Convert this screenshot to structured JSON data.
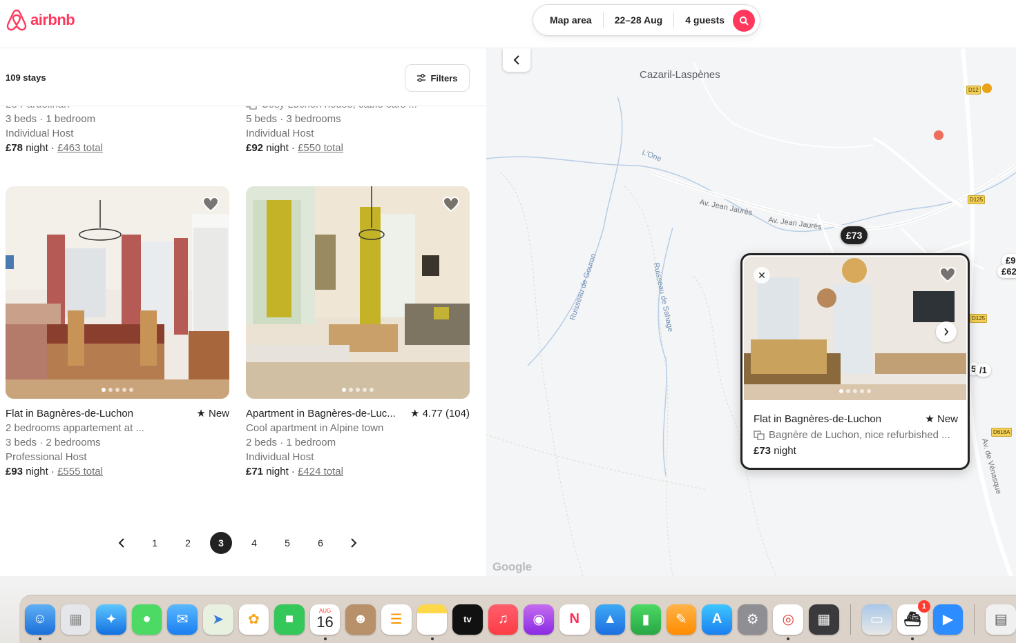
{
  "header": {
    "logo_text": "airbnb",
    "search": {
      "location": "Map area",
      "dates": "22–28 Aug",
      "guests": "4 guests"
    }
  },
  "results": {
    "count": "109 stays",
    "filters_label": "Filters"
  },
  "cards_top": [
    {
      "subtitle": "Le Pardeilhan",
      "beds": "3 beds · 1 bedroom",
      "host": "Individual Host",
      "price": "£78",
      "price_unit": "night",
      "total": "£463 total"
    },
    {
      "subtitle": "Cosy Luchon house, cable cars ...",
      "beds": "5 beds · 3 bedrooms",
      "host": "Individual Host",
      "price": "£92",
      "price_unit": "night",
      "total": "£550 total"
    }
  ],
  "cards": [
    {
      "title": "Flat in Bagnères-de-Luchon",
      "rating": "New",
      "subtitle": "2 bedrooms appartement at ...",
      "beds": "3 beds · 2 bedrooms",
      "host": "Professional Host",
      "price": "£93",
      "price_unit": "night",
      "total": "£555 total"
    },
    {
      "title": "Apartment in Bagnères-de-Luc...",
      "rating": "4.77 (104)",
      "subtitle": "Cool apartment in Alpine town",
      "beds": "2 beds · 1 bedroom",
      "host": "Individual Host",
      "price": "£71",
      "price_unit": "night",
      "total": "£424 total"
    }
  ],
  "price_separator": "·",
  "pagination": {
    "pages": [
      "1",
      "2",
      "3",
      "4",
      "5",
      "6"
    ],
    "current": "3"
  },
  "map": {
    "place_label": "Cazaril-Laspènes",
    "river_one": "L'One",
    "road_1": "Av. Jean Jaurès",
    "road_2": "Av. Jean Jaurès",
    "road_3": "Av. de Vénasque",
    "stream_1": "Ruisseau de Gouron",
    "stream_2": "Ruisseau de Sahage",
    "signs": [
      "D125",
      "D125",
      "D125",
      "D618A"
    ],
    "sign_top": "D12",
    "pin_active": "£73",
    "side_pin_a": "£9",
    "side_pin_b": "£62",
    "side_pin_c": "5",
    "side_pin_d": "/1",
    "google": "Google",
    "popup": {
      "title": "Flat in Bagnères-de-Luchon",
      "rating": "New",
      "desc": "Bagnère de Luchon, nice refurbished ...",
      "price": "£73",
      "price_unit": "night"
    }
  },
  "dock": {
    "calendar_month": "AUG",
    "calendar_day": "16",
    "tv_label": "tv",
    "badge": "1"
  },
  "colors": {
    "brand": "#ff385c",
    "text": "#222222",
    "muted": "#717171"
  }
}
